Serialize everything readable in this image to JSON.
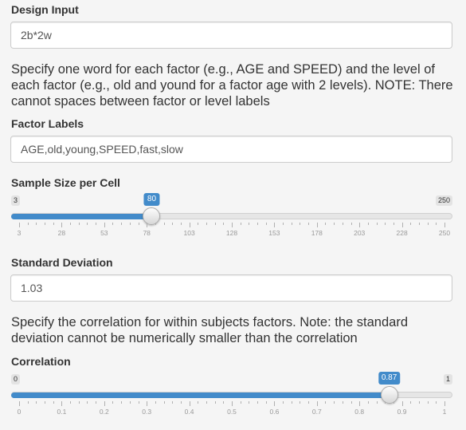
{
  "design": {
    "label": "Design Input",
    "value": "2b*2w"
  },
  "factor_help": "Specify one word for each factor (e.g., AGE and SPEED) and the level of each factor (e.g., old and yound for a factor age with 2 levels). NOTE: There cannot spaces between factor or level labels",
  "factor_labels": {
    "label": "Factor Labels",
    "value": "AGE,old,young,SPEED,fast,slow"
  },
  "sample_size": {
    "label": "Sample Size per Cell",
    "min": 3,
    "max": 250,
    "value": 80,
    "min_label": "3",
    "max_label": "250",
    "value_label": "80",
    "ticks": [
      "3",
      "28",
      "53",
      "78",
      "103",
      "128",
      "153",
      "178",
      "203",
      "228",
      "250"
    ]
  },
  "sd": {
    "label": "Standard Deviation",
    "value": "1.03"
  },
  "corr_help": "Specify the correlation for within subjects factors. Note: the standard deviation cannot be numerically smaller than the correlation",
  "correlation": {
    "label": "Correlation",
    "min": 0,
    "max": 1,
    "value": 0.87,
    "min_label": "0",
    "max_label": "1",
    "value_label": "0.87",
    "ticks": [
      "0",
      "0.1",
      "0.2",
      "0.3",
      "0.4",
      "0.5",
      "0.6",
      "0.7",
      "0.8",
      "0.9",
      "1"
    ]
  },
  "colors": {
    "accent": "#428bca",
    "background": "#f5f5f5"
  }
}
